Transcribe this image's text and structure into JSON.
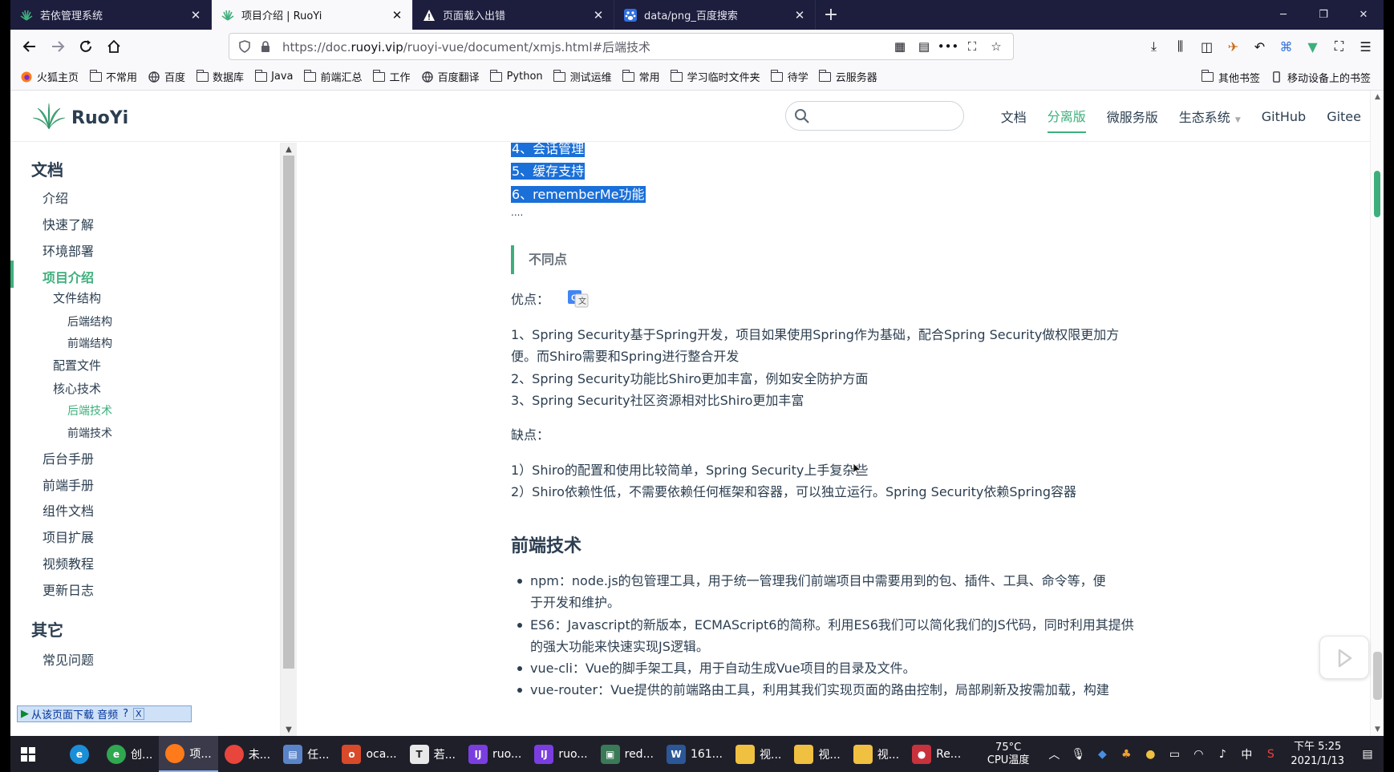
{
  "browser": {
    "tabs": [
      {
        "label": "若依管理系统",
        "icon": "ruoyi-leaf-icon",
        "active": false
      },
      {
        "label": "项目介绍 | RuoYi",
        "icon": "ruoyi-leaf-icon",
        "active": true
      },
      {
        "label": "页面载入出错",
        "icon": "warning-icon",
        "active": false
      },
      {
        "label": "data/png_百度搜索",
        "icon": "baidu-paw-icon",
        "active": false
      }
    ],
    "url": {
      "prefix": "https://doc.",
      "domain": "ruoyi.vip",
      "path": "/ruoyi-vue/document/xmjs.html#后端技术"
    },
    "bookmarks": [
      {
        "label": "火狐主页",
        "icon": "firefox-icon"
      },
      {
        "label": "不常用",
        "icon": "folder-icon"
      },
      {
        "label": "百度",
        "icon": "globe-icon"
      },
      {
        "label": "数据库",
        "icon": "folder-icon"
      },
      {
        "label": "Java",
        "icon": "folder-icon"
      },
      {
        "label": "前端汇总",
        "icon": "folder-icon"
      },
      {
        "label": "工作",
        "icon": "folder-icon"
      },
      {
        "label": "百度翻译",
        "icon": "globe-icon"
      },
      {
        "label": "Python",
        "icon": "folder-icon"
      },
      {
        "label": "测试运维",
        "icon": "folder-icon"
      },
      {
        "label": "常用",
        "icon": "folder-icon"
      },
      {
        "label": "学习临时文件夹",
        "icon": "folder-icon"
      },
      {
        "label": "待学",
        "icon": "folder-icon"
      },
      {
        "label": "云服务器",
        "icon": "folder-icon"
      }
    ],
    "bookmarks_right": [
      {
        "label": "其他书签",
        "icon": "folder-icon"
      },
      {
        "label": "移动设备上的书签",
        "icon": "mobile-icon"
      }
    ]
  },
  "site": {
    "logo_text": "RuoYi",
    "nav": [
      {
        "label": "文档",
        "active": false
      },
      {
        "label": "分离版",
        "active": true
      },
      {
        "label": "微服务版",
        "active": false
      },
      {
        "label": "生态系统",
        "active": false,
        "dropdown": true
      },
      {
        "label": "GitHub",
        "active": false
      },
      {
        "label": "Gitee",
        "active": false
      }
    ]
  },
  "sidebar": {
    "group1": "文档",
    "items": [
      {
        "label": "介绍",
        "level": 1
      },
      {
        "label": "快速了解",
        "level": 1
      },
      {
        "label": "环境部署",
        "level": 1
      },
      {
        "label": "项目介绍",
        "level": 1,
        "active": true
      },
      {
        "label": "文件结构",
        "level": 2
      },
      {
        "label": "后端结构",
        "level": 3
      },
      {
        "label": "前端结构",
        "level": 3
      },
      {
        "label": "配置文件",
        "level": 2
      },
      {
        "label": "核心技术",
        "level": 2
      },
      {
        "label": "后端技术",
        "level": 3,
        "active": true
      },
      {
        "label": "前端技术",
        "level": 3
      },
      {
        "label": "后台手册",
        "level": 1
      },
      {
        "label": "前端手册",
        "level": 1
      },
      {
        "label": "组件文档",
        "level": 1
      },
      {
        "label": "项目扩展",
        "level": 1
      },
      {
        "label": "视频教程",
        "level": 1
      },
      {
        "label": "更新日志",
        "level": 1
      }
    ],
    "group2": "其它",
    "group2_items": [
      {
        "label": "常见问题"
      }
    ]
  },
  "download_bar": {
    "label": "从该页面下载 音频",
    "help": "?",
    "close": "X"
  },
  "content": {
    "highlighted": [
      "4、会话管理",
      "5、缓存支持",
      "6、rememberMe功能"
    ],
    "ellipsis": "....",
    "quote": "不同点",
    "pros_label": "优点：",
    "pros": [
      "1、Spring Security基于Spring开发，项目如果使用Spring作为基础，配合Spring Security做权限更加方",
      "便。而Shiro需要和Spring进行整合开发",
      "2、Spring Security功能比Shiro更加丰富，例如安全防护方面",
      "3、Spring Security社区资源相对比Shiro更加丰富"
    ],
    "cons_label": "缺点：",
    "cons": [
      "1）Shiro的配置和使用比较简单，Spring Security上手复杂些",
      "2）Shiro依赖性低，不需要依赖任何框架和容器，可以独立运行。Spring Security依赖Spring容器"
    ],
    "heading_frontend": "前端技术",
    "frontend_items": [
      {
        "line1": "npm：node.js的包管理工具，用于统一管理我们前端项目中需要用到的包、插件、工具、命令等，便",
        "line2": "于开发和维护。"
      },
      {
        "line1": "ES6：Javascript的新版本，ECMAScript6的简称。利用ES6我们可以简化我们的JS代码，同时利用其提供",
        "line2": "的强大功能来快速实现JS逻辑。"
      },
      {
        "line1": "vue-cli：Vue的脚手架工具，用于自动生成Vue项目的目录及文件。",
        "line2": ""
      },
      {
        "line1": "vue-router：Vue提供的前端路由工具，利用其我们实现页面的路由控制，局部刷新及按需加载，构建",
        "line2": ""
      }
    ]
  },
  "taskbar": {
    "items": [
      {
        "label": "",
        "icon": "edge-icon",
        "color": "#1b8ed8"
      },
      {
        "label": "创...",
        "icon": "browser360-icon",
        "color": "#2fa84f"
      },
      {
        "label": "项...",
        "icon": "firefox-icon",
        "color": "#ff7a1a",
        "active": true
      },
      {
        "label": "未...",
        "icon": "chrome-icon",
        "color": "#e8453c"
      },
      {
        "label": "任...",
        "icon": "tasks-icon",
        "color": "#5a84c8"
      },
      {
        "label": "oca...",
        "icon": "office-icon",
        "color": "#d84a2a"
      },
      {
        "label": "若...",
        "icon": "typora-icon",
        "color": "#e8e8e8"
      },
      {
        "label": "ruo...",
        "icon": "intellij-icon",
        "color": "#7a3ee0"
      },
      {
        "label": "ruo...",
        "icon": "intellij-icon",
        "color": "#7a3ee0"
      },
      {
        "label": "red...",
        "icon": "terminal-icon",
        "color": "#3b7a57"
      },
      {
        "label": "161...",
        "icon": "word-icon",
        "color": "#2b5797"
      },
      {
        "label": "视...",
        "icon": "folder-icon",
        "color": "#f0c040"
      },
      {
        "label": "视...",
        "icon": "folder-icon",
        "color": "#f0c040"
      },
      {
        "label": "视...",
        "icon": "folder-icon",
        "color": "#f0c040"
      },
      {
        "label": "Re...",
        "icon": "recorder-icon",
        "color": "#c8323c"
      }
    ],
    "temperature": "75°C",
    "temperature_label": "CPU温度",
    "ime": "中",
    "time": "下午 5:25",
    "date": "2021/1/13"
  },
  "colors": {
    "accent": "#3eaf7c",
    "highlight": "#1a6fd8",
    "text": "#2c3e50",
    "tabstrip": "#1d1d3d"
  }
}
